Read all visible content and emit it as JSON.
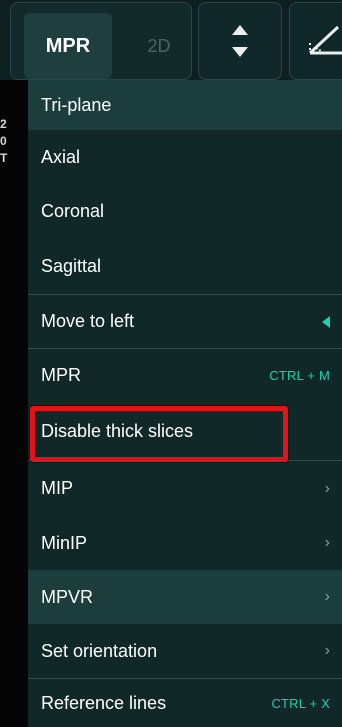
{
  "toolbar": {
    "mpr_label": "MPR",
    "two_d_label": "2D"
  },
  "left_glyphs": [
    "2",
    "0",
    "T"
  ],
  "menu": {
    "items": [
      {
        "label": "Tri-plane",
        "highlighted": true
      },
      {
        "label": "Axial"
      },
      {
        "label": "Coronal"
      },
      {
        "label": "Sagittal"
      },
      {
        "label": "Move to left",
        "indicator": "left-triangle"
      },
      {
        "label": "MPR",
        "shortcut": "CTRL + M"
      },
      {
        "label": "Disable thick slices",
        "focused": true
      },
      {
        "label": "MIP",
        "submenu": "›"
      },
      {
        "label": "MinIP",
        "submenu": "›"
      },
      {
        "label": "MPVR",
        "submenu": "›",
        "highlighted": true
      },
      {
        "label": "Set orientation",
        "submenu": "›"
      },
      {
        "label": "Reference lines",
        "shortcut": "CTRL + X"
      }
    ]
  },
  "colors": {
    "accent": "#1fd0ad",
    "focus_box": "#e0141b",
    "menu_bg": "#102928",
    "highlight_bg": "#1b3d3c"
  }
}
